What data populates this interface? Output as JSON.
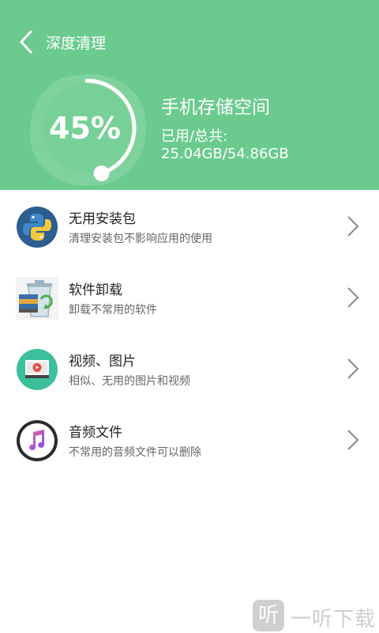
{
  "header": {
    "title": "深度清理",
    "back_icon": "back-chevron-icon",
    "background": "#6bcb8f"
  },
  "storage": {
    "percent_label": "45%",
    "percent": 45,
    "title": "手机存储空间",
    "used_label": "已用/总共:",
    "used_value": "25.04GB/54.86GB"
  },
  "items": [
    {
      "name": "无用安装包",
      "desc": "清理安装包不影响应用的使用",
      "icon": "python-package-icon"
    },
    {
      "name": "软件卸载",
      "desc": "卸载不常用的软件",
      "icon": "trash-bin-icon"
    },
    {
      "name": "视频、图片",
      "desc": "相似、无用的图片和视频",
      "icon": "video-player-icon"
    },
    {
      "name": "音频文件",
      "desc": "不常用的音频文件可以删除",
      "icon": "music-note-icon"
    }
  ],
  "watermark": {
    "glyph": "听",
    "text": "一听下载"
  }
}
